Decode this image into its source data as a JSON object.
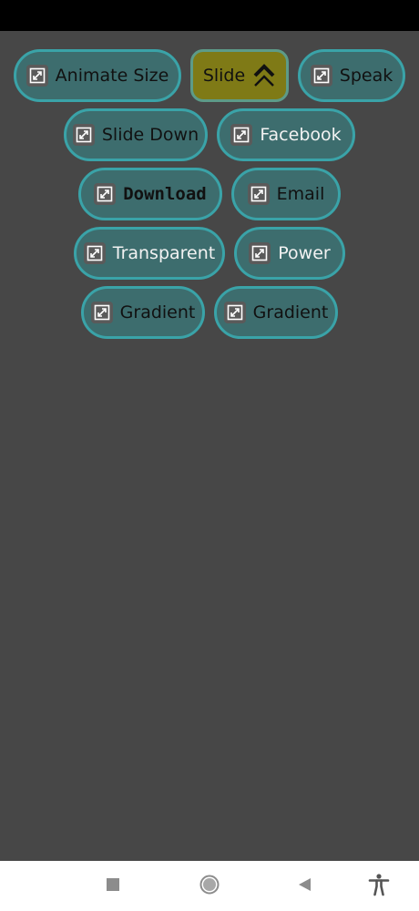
{
  "buttons": {
    "animate_size": "Animate Size",
    "slide": "Slide",
    "speak": "Speak",
    "slide_down": "Slide Down",
    "facebook": "Facebook",
    "download": "Download",
    "email": "Email",
    "transparent": "Transparent",
    "power": "Power",
    "gradient_1": "Gradient",
    "gradient_2": "Gradient"
  },
  "icons": {
    "button_icon": "expand-icon",
    "slide_icon": "double-chevron-up-icon",
    "nav": [
      "recent-apps-icon",
      "home-icon",
      "back-icon",
      "accessibility-icon"
    ]
  },
  "colors": {
    "background": "#474747",
    "button_fill": "#3d6d6e",
    "button_border": "#3aa3a8",
    "slide_fill": "#7f7a16"
  }
}
